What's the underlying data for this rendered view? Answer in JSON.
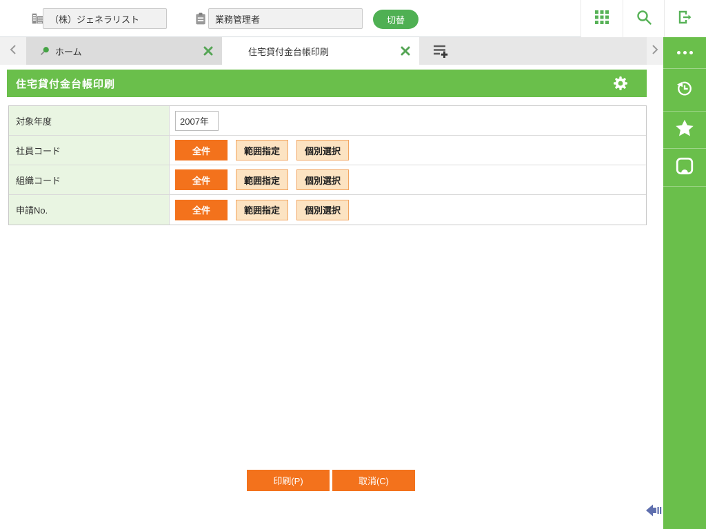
{
  "topbar": {
    "company_value": "（株）ジェネラリスト",
    "role_value": "業務管理者",
    "switch_label": "切替"
  },
  "tabbar": {
    "tabs": [
      {
        "label": "ホーム",
        "pinned": true,
        "active": false
      },
      {
        "label": "住宅貸付金台帳印刷",
        "pinned": false,
        "active": true
      }
    ]
  },
  "page": {
    "title": "住宅貸付金台帳印刷"
  },
  "form": {
    "rows": [
      {
        "label": "対象年度"
      },
      {
        "label": "社員コード"
      },
      {
        "label": "組織コード"
      },
      {
        "label": "申請No."
      }
    ],
    "year_value": "2007年",
    "selection_buttons": {
      "all": "全件",
      "range": "範囲指定",
      "individual": "個別選択"
    }
  },
  "actions": {
    "print": "印刷(P)",
    "cancel": "取消(C)"
  },
  "icons": {
    "topbar": [
      "building-icon",
      "clipboard-icon",
      "apps-grid-icon",
      "search-icon",
      "logout-icon"
    ],
    "tabbar": [
      "chevron-left-icon",
      "pin-icon",
      "close-icon",
      "add-tab-icon",
      "chevron-right-icon"
    ],
    "sidebar": [
      "more-icon",
      "history-icon",
      "star-icon",
      "tray-icon"
    ],
    "page": [
      "gear-icon",
      "collapse-arrow-icon"
    ]
  },
  "colors": {
    "green": "#6abf4b",
    "switch_green": "#4fb053",
    "orange": "#f3721c",
    "light_orange_bg": "#fce3c2",
    "light_orange_border": "#f2a561",
    "label_cell_green": "#e9f5e2",
    "collapse_arrow_blue": "#5f6fae"
  }
}
